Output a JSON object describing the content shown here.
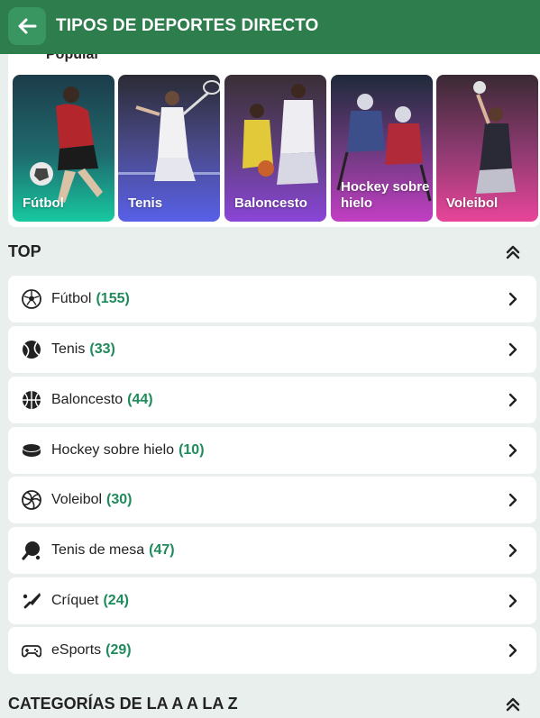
{
  "header": {
    "title": "TIPOS DE DEPORTES DIRECTO"
  },
  "popular": {
    "label": "Popular",
    "tiles": [
      {
        "label": "Fútbol"
      },
      {
        "label": "Tenis"
      },
      {
        "label": "Baloncesto"
      },
      {
        "label": "Hockey sobre hielo"
      },
      {
        "label": "Voleibol"
      }
    ]
  },
  "top": {
    "title": "TOP",
    "items": [
      {
        "label": "Fútbol",
        "count": "(155)",
        "icon": "soccer-ball-icon"
      },
      {
        "label": "Tenis",
        "count": "(33)",
        "icon": "tennis-ball-icon"
      },
      {
        "label": "Baloncesto",
        "count": "(44)",
        "icon": "basketball-icon"
      },
      {
        "label": "Hockey sobre hielo",
        "count": "(10)",
        "icon": "hockey-puck-icon"
      },
      {
        "label": "Voleibol",
        "count": "(30)",
        "icon": "volleyball-icon"
      },
      {
        "label": "Tenis de mesa",
        "count": "(47)",
        "icon": "ping-pong-icon"
      },
      {
        "label": "Críquet",
        "count": "(24)",
        "icon": "cricket-bat-icon"
      },
      {
        "label": "eSports",
        "count": "(29)",
        "icon": "gamepad-icon"
      }
    ]
  },
  "az": {
    "title": "CATEGORÍAS DE LA A A LA Z"
  },
  "colors": {
    "header": "#2e7d4c",
    "accent": "#1f8a5b",
    "background": "#e9efec"
  }
}
